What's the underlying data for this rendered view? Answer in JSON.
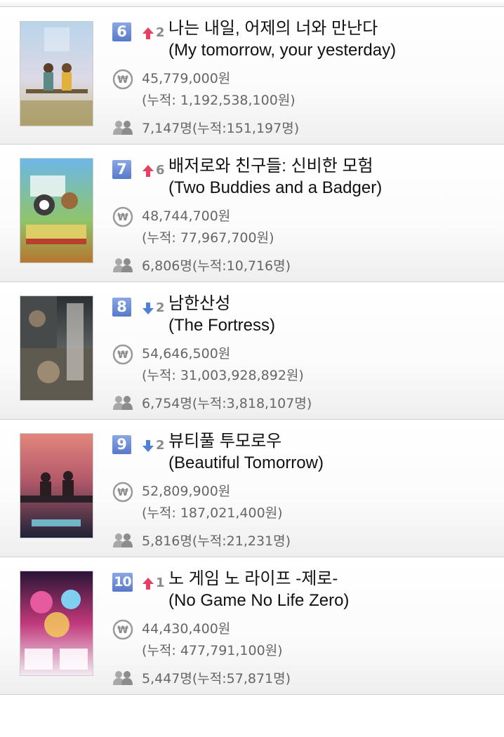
{
  "labels": {
    "currency_icon": "₩"
  },
  "colors": {
    "up": "#e63f62",
    "down": "#4f7fd6",
    "rank_badge": "#6a8ad5"
  },
  "movies": [
    {
      "rank": "6",
      "change_dir": "up",
      "change": "2",
      "title_ko": "나는 내일, 어제의 너와 만난다",
      "title_en": "(My tomorrow, your yesterday)",
      "revenue": "45,779,000원",
      "revenue_total": "(누적: 1,192,538,100원)",
      "audience": "7,147명(누적:151,197명)"
    },
    {
      "rank": "7",
      "change_dir": "up",
      "change": "6",
      "title_ko": "배저로와 친구들: 신비한 모험",
      "title_en": "(Two Buddies and a Badger)",
      "revenue": "48,744,700원",
      "revenue_total": "(누적: 77,967,700원)",
      "audience": "6,806명(누적:10,716명)"
    },
    {
      "rank": "8",
      "change_dir": "down",
      "change": "2",
      "title_ko": "남한산성",
      "title_en": "(The Fortress)",
      "revenue": "54,646,500원",
      "revenue_total": "(누적: 31,003,928,892원)",
      "audience": "6,754명(누적:3,818,107명)"
    },
    {
      "rank": "9",
      "change_dir": "down",
      "change": "2",
      "title_ko": "뷰티풀 투모로우",
      "title_en": "(Beautiful Tomorrow)",
      "revenue": "52,809,900원",
      "revenue_total": "(누적: 187,021,400원)",
      "audience": "5,816명(누적:21,231명)"
    },
    {
      "rank": "10",
      "change_dir": "up",
      "change": "1",
      "title_ko": "노 게임 노 라이프 -제로-",
      "title_en": "(No Game No Life Zero)",
      "revenue": "44,430,400원",
      "revenue_total": "(누적: 477,791,100원)",
      "audience": "5,447명(누적:57,871명)"
    }
  ]
}
